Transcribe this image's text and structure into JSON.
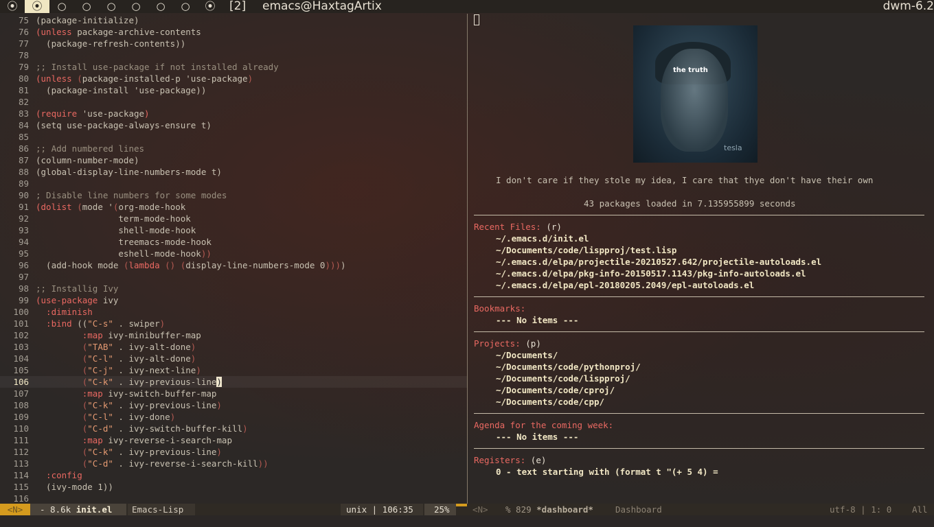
{
  "bar": {
    "tags": [
      "⦿",
      "⦿",
      "○",
      "○",
      "○",
      "○",
      "○",
      "○",
      "⦿"
    ],
    "layout": "[2]",
    "title": "emacs@HaxtagArtix",
    "status": "dwm-6.2"
  },
  "editor": {
    "lines": [
      {
        "n": "75",
        "t": [
          [
            "",
            "(package-initialize)"
          ]
        ]
      },
      {
        "n": "76",
        "t": [
          [
            "kw",
            "(unless "
          ],
          [
            "",
            "package-archive-contents"
          ]
        ]
      },
      {
        "n": "77",
        "t": [
          [
            "",
            "  (package-refresh-contents))"
          ]
        ]
      },
      {
        "n": "78",
        "t": []
      },
      {
        "n": "79",
        "t": [
          [
            "cm",
            ";; Install use-package if not installed already"
          ]
        ]
      },
      {
        "n": "80",
        "t": [
          [
            "kw",
            "(unless "
          ],
          [
            "pb",
            "("
          ],
          [
            "",
            "package-installed-p 'use-package"
          ],
          [
            "pb",
            ")"
          ]
        ]
      },
      {
        "n": "81",
        "t": [
          [
            "",
            "  (package-install 'use-package))"
          ]
        ]
      },
      {
        "n": "82",
        "t": []
      },
      {
        "n": "83",
        "t": [
          [
            "kw",
            "(require "
          ],
          [
            "",
            "'use-package"
          ],
          [
            "kw",
            ")"
          ]
        ]
      },
      {
        "n": "84",
        "t": [
          [
            "",
            "(setq use-package-always-ensure t)"
          ]
        ]
      },
      {
        "n": "85",
        "t": []
      },
      {
        "n": "86",
        "t": [
          [
            "cm",
            ";; Add numbered lines"
          ]
        ]
      },
      {
        "n": "87",
        "t": [
          [
            "",
            "(column-number-mode)"
          ]
        ]
      },
      {
        "n": "88",
        "t": [
          [
            "",
            "(global-display-line-numbers-mode t)"
          ]
        ]
      },
      {
        "n": "89",
        "t": []
      },
      {
        "n": "90",
        "t": [
          [
            "cm",
            "; Disable line numbers for some modes"
          ]
        ]
      },
      {
        "n": "91",
        "t": [
          [
            "kw",
            "(dolist "
          ],
          [
            "pb",
            "("
          ],
          [
            "",
            "mode '"
          ],
          [
            "pb",
            "("
          ],
          [
            "",
            "org-mode-hook"
          ]
        ]
      },
      {
        "n": "92",
        "t": [
          [
            "",
            "                term-mode-hook"
          ]
        ]
      },
      {
        "n": "93",
        "t": [
          [
            "",
            "                shell-mode-hook"
          ]
        ]
      },
      {
        "n": "94",
        "t": [
          [
            "",
            "                treemacs-mode-hook"
          ]
        ]
      },
      {
        "n": "95",
        "t": [
          [
            "",
            "                eshell-mode-hook"
          ],
          [
            "pb",
            "))"
          ]
        ]
      },
      {
        "n": "96",
        "t": [
          [
            "",
            "  (add-hook mode "
          ],
          [
            "pb",
            "("
          ],
          [
            "kw",
            "lambda "
          ],
          [
            "pb",
            "() ("
          ],
          [
            "",
            "display-line-numbers-mode 0"
          ],
          [
            "pb",
            ")))"
          ],
          [
            "",
            ")"
          ]
        ]
      },
      {
        "n": "97",
        "t": []
      },
      {
        "n": "98",
        "t": [
          [
            "cm",
            ";; Installig Ivy"
          ]
        ]
      },
      {
        "n": "99",
        "t": [
          [
            "kw",
            "(use-package "
          ],
          [
            "",
            "ivy"
          ]
        ]
      },
      {
        "n": "100",
        "t": [
          [
            "kwd",
            "  :diminish"
          ]
        ]
      },
      {
        "n": "101",
        "t": [
          [
            "kwd",
            "  :bind "
          ],
          [
            "",
            "(("
          ],
          [
            "str",
            "\"C-s\""
          ],
          [
            "",
            " . swiper"
          ],
          [
            "pb",
            ")"
          ]
        ]
      },
      {
        "n": "102",
        "t": [
          [
            "kwd",
            "         :map "
          ],
          [
            "",
            "ivy-minibuffer-map"
          ]
        ]
      },
      {
        "n": "103",
        "t": [
          [
            "pb",
            "         ("
          ],
          [
            "str",
            "\"TAB\""
          ],
          [
            "",
            " . ivy-alt-done"
          ],
          [
            "pb",
            ")"
          ]
        ]
      },
      {
        "n": "104",
        "t": [
          [
            "pb",
            "         ("
          ],
          [
            "str",
            "\"C-l\""
          ],
          [
            "",
            " . ivy-alt-done"
          ],
          [
            "pb",
            ")"
          ]
        ]
      },
      {
        "n": "105",
        "t": [
          [
            "pb",
            "         ("
          ],
          [
            "str",
            "\"C-j\""
          ],
          [
            "",
            " . ivy-next-line"
          ],
          [
            "pb",
            ")"
          ]
        ]
      },
      {
        "n": "106",
        "cur": true,
        "t": [
          [
            "pb",
            "         ("
          ],
          [
            "str",
            "\"C-k\""
          ],
          [
            "",
            " . ivy-previous-line"
          ],
          [
            "cursor",
            ")"
          ]
        ]
      },
      {
        "n": "107",
        "t": [
          [
            "kwd",
            "         :map "
          ],
          [
            "",
            "ivy-switch-buffer-map"
          ]
        ]
      },
      {
        "n": "108",
        "t": [
          [
            "pb",
            "         ("
          ],
          [
            "str",
            "\"C-k\""
          ],
          [
            "",
            " . ivy-previous-line"
          ],
          [
            "pb",
            ")"
          ]
        ]
      },
      {
        "n": "109",
        "t": [
          [
            "pb",
            "         ("
          ],
          [
            "str",
            "\"C-l\""
          ],
          [
            "",
            " . ivy-done"
          ],
          [
            "pb",
            ")"
          ]
        ]
      },
      {
        "n": "110",
        "t": [
          [
            "pb",
            "         ("
          ],
          [
            "str",
            "\"C-d\""
          ],
          [
            "",
            " . ivy-switch-buffer-kill"
          ],
          [
            "pb",
            ")"
          ]
        ]
      },
      {
        "n": "111",
        "t": [
          [
            "kwd",
            "         :map "
          ],
          [
            "",
            "ivy-reverse-i-search-map"
          ]
        ]
      },
      {
        "n": "112",
        "t": [
          [
            "pb",
            "         ("
          ],
          [
            "str",
            "\"C-k\""
          ],
          [
            "",
            " . ivy-previous-line"
          ],
          [
            "pb",
            ")"
          ]
        ]
      },
      {
        "n": "113",
        "t": [
          [
            "pb",
            "         ("
          ],
          [
            "str",
            "\"C-d\""
          ],
          [
            "",
            " . ivy-reverse-i-search-kill"
          ],
          [
            "pb",
            "))"
          ]
        ]
      },
      {
        "n": "114",
        "t": [
          [
            "kwd",
            "  :config"
          ]
        ]
      },
      {
        "n": "115",
        "t": [
          [
            "",
            "  (ivy-mode 1))"
          ]
        ]
      },
      {
        "n": "116",
        "t": []
      }
    ]
  },
  "dashboard": {
    "banner_text": "the truth",
    "banner_caption": "tesla",
    "quote": "I don't care if they stole my idea, I care that thye don't have their own",
    "loaded": "43 packages loaded in 7.135955899 seconds",
    "recent": {
      "heading": "Recent Files:",
      "key": "(r)",
      "items": [
        "~/.emacs.d/init.el",
        "~/Documents/code/lispproj/test.lisp",
        "~/.emacs.d/elpa/projectile-20210527.642/projectile-autoloads.el",
        "~/.emacs.d/elpa/pkg-info-20150517.1143/pkg-info-autoloads.el",
        "~/.emacs.d/elpa/epl-20180205.2049/epl-autoloads.el"
      ]
    },
    "bookmarks": {
      "heading": "Bookmarks:",
      "empty": "--- No items ---"
    },
    "projects": {
      "heading": "Projects:",
      "key": "(p)",
      "items": [
        "~/Documents/",
        "~/Documents/code/pythonproj/",
        "~/Documents/code/lispproj/",
        "~/Documents/code/cproj/",
        "~/Documents/code/cpp/"
      ]
    },
    "agenda": {
      "heading": "Agenda for the coming week:",
      "empty": "--- No items ---"
    },
    "registers": {
      "heading": "Registers:",
      "key": "(e)",
      "items": [
        "0 - text starting with (format t \"(+ 5 4) ="
      ]
    }
  },
  "modeline": {
    "left_state": "<N>",
    "left_size": "- 8.6k ",
    "left_buffer": "init.el",
    "left_major": "Emacs-Lisp",
    "left_encoding": "unix | 106:35",
    "left_percent": "25%",
    "right_state": "<N>",
    "right_size": "% 829 ",
    "right_buffer": "*dashboard*",
    "right_major": "Dashboard",
    "right_encoding": "utf-8 | 1: 0",
    "right_all": "All"
  }
}
